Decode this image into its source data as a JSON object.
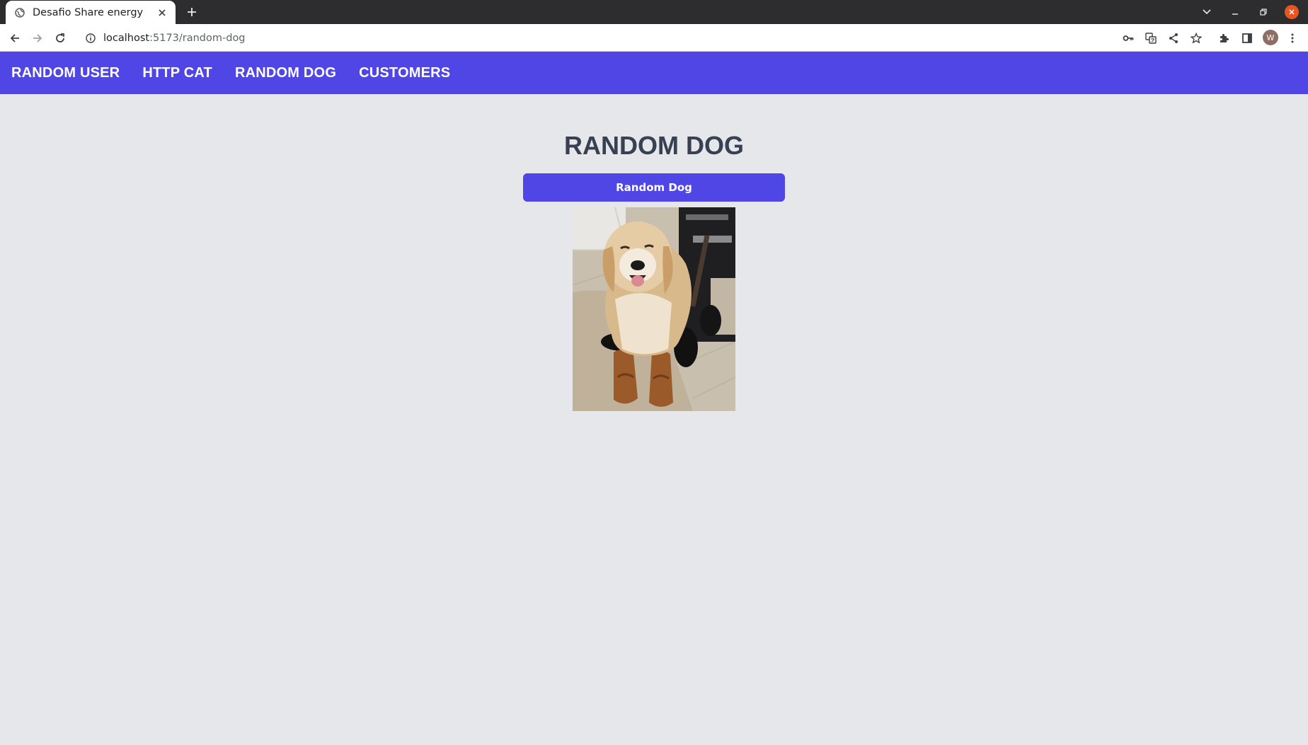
{
  "browser": {
    "tab_title": "Desafio Share energy",
    "url_host": "localhost",
    "url_path": ":5173/random-dog",
    "profile_initial": "W"
  },
  "nav": {
    "links": [
      {
        "label": "RANDOM USER"
      },
      {
        "label": "HTTP CAT"
      },
      {
        "label": "RANDOM DOG"
      },
      {
        "label": "CUSTOMERS"
      }
    ]
  },
  "main": {
    "title": "RANDOM DOG",
    "button_label": "Random Dog"
  },
  "colors": {
    "nav_bg": "#4f46e5",
    "page_bg": "#e5e7eb",
    "title": "#374151",
    "button_bg": "#4f46e5"
  }
}
